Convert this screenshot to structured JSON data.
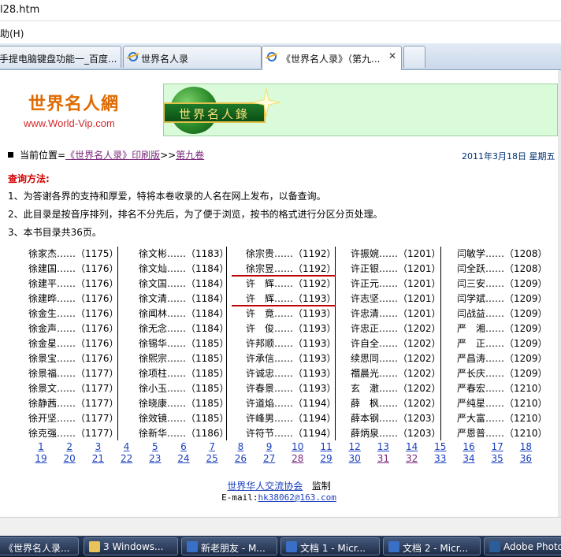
{
  "window": {
    "title_fragment": "l28.htm",
    "menu_fragment": "助(H)"
  },
  "tabs": [
    {
      "label": "手提电脑键盘功能一_百度...",
      "active": false
    },
    {
      "label": "世界名人录",
      "active": false
    },
    {
      "label": "《世界名人录》（第九...",
      "active": true,
      "close": "✕"
    }
  ],
  "header": {
    "logo_title": "世界名人網",
    "logo_url": "www.World-Vip.com",
    "banner_text": "世界名人錄"
  },
  "location": {
    "prefix": "当前位置=",
    "link1": "《世界名人录》印刷版",
    "sep": ">>",
    "link2": "第九卷",
    "date": "2011年3月18日  星期五"
  },
  "query": {
    "title": "查询方法:",
    "lines": [
      "1、为答谢各界的支持和厚爱，特将本卷收录的人名在网上发布，以备查询。",
      "2、此目录是按音序排列，排名不分先后，为了便于浏览，按书的格式进行分区分页处理。",
      "3、本书目录共36页。"
    ]
  },
  "name_columns": [
    [
      "徐家杰……（1175）",
      "徐建国……（1176）",
      "徐建平……（1176）",
      "徐建晔……（1176）",
      "徐金生……（1176）",
      "徐金声……（1176）",
      "徐金星……（1176）",
      "徐景宝……（1176）",
      "徐景福……（1177）",
      "徐景文……（1177）",
      "徐静茜……（1177）",
      "徐开坚……（1177）",
      "徐克强……（1177）"
    ],
    [
      "徐文彬……（1183）",
      "徐文灿……（1184）",
      "徐文国……（1184）",
      "徐文清……（1184）",
      "徐闻林……（1184）",
      "徐无念……（1184）",
      "徐锡华……（1185）",
      "徐熙宗……（1185）",
      "徐项柱……（1185）",
      "徐小玉……（1185）",
      "徐晓康……（1185）",
      "徐效镜……（1185）",
      "徐新华……（1186）"
    ],
    [
      "徐宗贵……（1192）",
      "徐宗昱……（1192）",
      "许　辉……（1192）",
      "许　辉……（1193）",
      "许　竟……（1193）",
      "许　俊……（1193）",
      "许邦顺……（1193）",
      "许承信……（1193）",
      "许诚忠……（1193）",
      "许春景……（1193）",
      "许道焰……（1194）",
      "许峰男……（1194）",
      "许符节……（1194）"
    ],
    [
      "许振婉……（1201）",
      "许正银……（1201）",
      "许正元……（1201）",
      "许志坚……（1201）",
      "许忠清……（1201）",
      "许忠正……（1202）",
      "许自全……（1202）",
      "续思同……（1202）",
      "禤晨光……（1202）",
      "玄　澈……（1202）",
      "薛　枫……（1202）",
      "薛本钢……（1203）",
      "薛炳泉……（1203）"
    ],
    [
      "闫敏学……（1208）",
      "闫全跃……（1208）",
      "闫三安……（1209）",
      "闫学斌……（1209）",
      "闫战益……（1209）",
      "严　湘……（1209）",
      "严　正……（1209）",
      "严昌涛……（1209）",
      "严长庆……（1209）",
      "严春宏……（1210）",
      "严纯星……（1210）",
      "严大富……（1210）",
      "严恩普……（1210）"
    ]
  ],
  "pages_row1": [
    "1",
    "3",
    "5",
    "7",
    "9",
    "11",
    "13",
    "15",
    "17",
    "4",
    "6",
    "8",
    "10",
    "12",
    "14",
    "16",
    "18"
  ],
  "pages": {
    "row1": [
      "1",
      "2",
      "3",
      "4",
      "5",
      "6",
      "7",
      "8",
      "9",
      "10",
      "11",
      "12",
      "13",
      "14",
      "15",
      "16",
      "17",
      "18"
    ],
    "row2": [
      "19",
      "20",
      "21",
      "22",
      "23",
      "24",
      "25",
      "26",
      "27",
      "28",
      "29",
      "30",
      "31",
      "32",
      "33",
      "34",
      "35",
      "36"
    ],
    "visited_row2": [
      "28",
      "31",
      "32"
    ]
  },
  "footer": {
    "assoc": "世界华人交流协会",
    "supervise": "监制",
    "email_label": "E-mail:",
    "email": "hk38062@163.com"
  },
  "taskbar": [
    {
      "label": "《世界名人录..."
    },
    {
      "label": "3 Windows...",
      "count": "3"
    },
    {
      "label": "新老朋友 - M..."
    },
    {
      "label": "文档 1 - Micr..."
    },
    {
      "label": "文档 2 - Micr..."
    },
    {
      "label": "Adobe Photo"
    }
  ],
  "colors": {
    "accent_red": "#c00000",
    "link": "#1a3fbf",
    "banner_bg": "#d9fbd9"
  }
}
